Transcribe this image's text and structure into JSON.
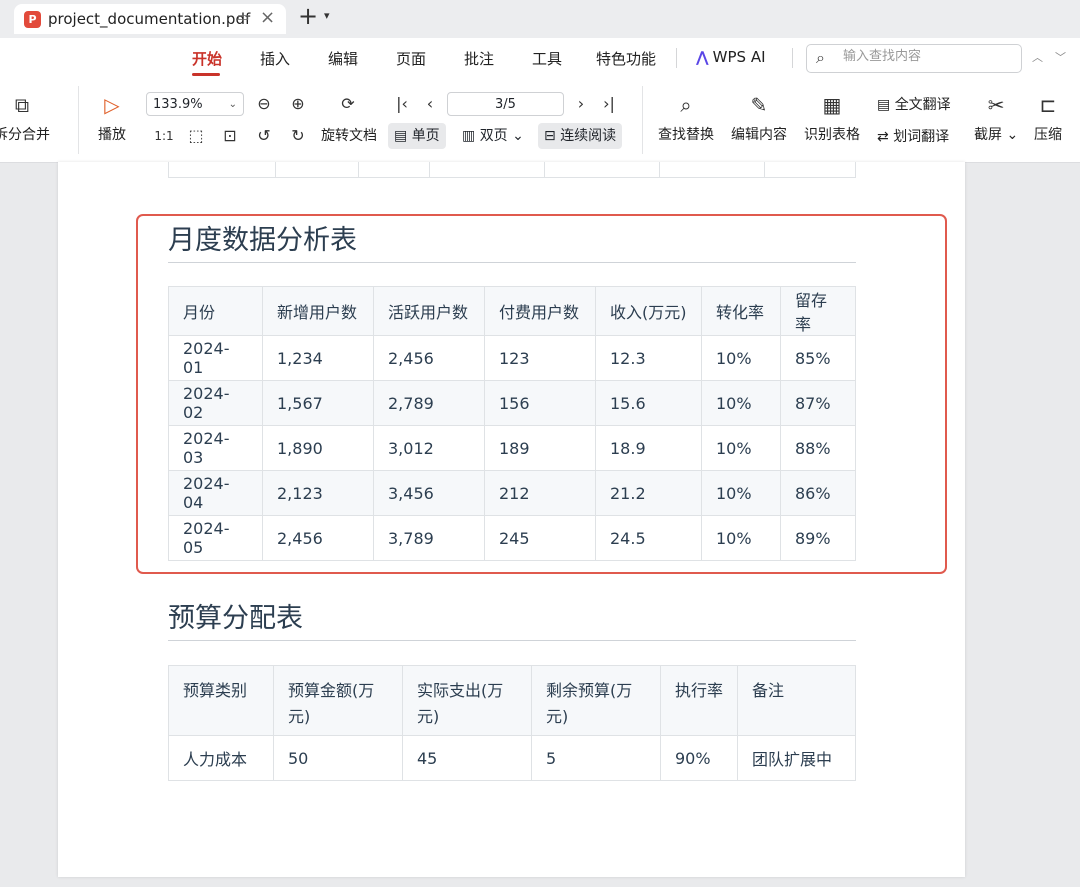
{
  "tab": {
    "title": "project_documentation.pdf",
    "logo": "P"
  },
  "menu": {
    "items": [
      "开始",
      "插入",
      "编辑",
      "页面",
      "批注",
      "工具",
      "特色功能"
    ],
    "wps_ai": "WPS AI",
    "search_placeholder": "输入查找内容"
  },
  "toolbar": {
    "split_merge": "拆分合并",
    "play": "播放",
    "zoom": "133.9%",
    "rotate": "旋转文档",
    "page_indicator": "3/5",
    "single": "单页",
    "double": "双页",
    "continuous": "连续阅读",
    "find_replace": "查找替换",
    "edit_content": "编辑内容",
    "recognize_table": "识别表格",
    "full_translate": "全文翻译",
    "word_translate": "划词翻译",
    "screenshot": "截屏",
    "compress": "压缩"
  },
  "doc": {
    "monthly_title": "月度数据分析表",
    "monthly_headers": [
      "月份",
      "新增用户数",
      "活跃用户数",
      "付费用户数",
      "收入(万元)",
      "转化率",
      "留存率"
    ],
    "monthly_rows": [
      [
        "2024-01",
        "1,234",
        "2,456",
        "123",
        "12.3",
        "10%",
        "85%"
      ],
      [
        "2024-02",
        "1,567",
        "2,789",
        "156",
        "15.6",
        "10%",
        "87%"
      ],
      [
        "2024-03",
        "1,890",
        "3,012",
        "189",
        "18.9",
        "10%",
        "88%"
      ],
      [
        "2024-04",
        "2,123",
        "3,456",
        "212",
        "21.2",
        "10%",
        "86%"
      ],
      [
        "2024-05",
        "2,456",
        "3,789",
        "245",
        "24.5",
        "10%",
        "89%"
      ]
    ],
    "budget_title": "预算分配表",
    "budget_headers": [
      "预算类别",
      "预算金额(万元)",
      "实际支出(万元)",
      "剩余预算(万元)",
      "执行率",
      "备注"
    ],
    "budget_rows": [
      [
        "人力成本",
        "50",
        "45",
        "5",
        "90%",
        "团队扩展中"
      ]
    ]
  },
  "colors": {
    "accent": "#c9332a",
    "highlight_border": "#e05a4e",
    "heading": "#2c3e50"
  }
}
